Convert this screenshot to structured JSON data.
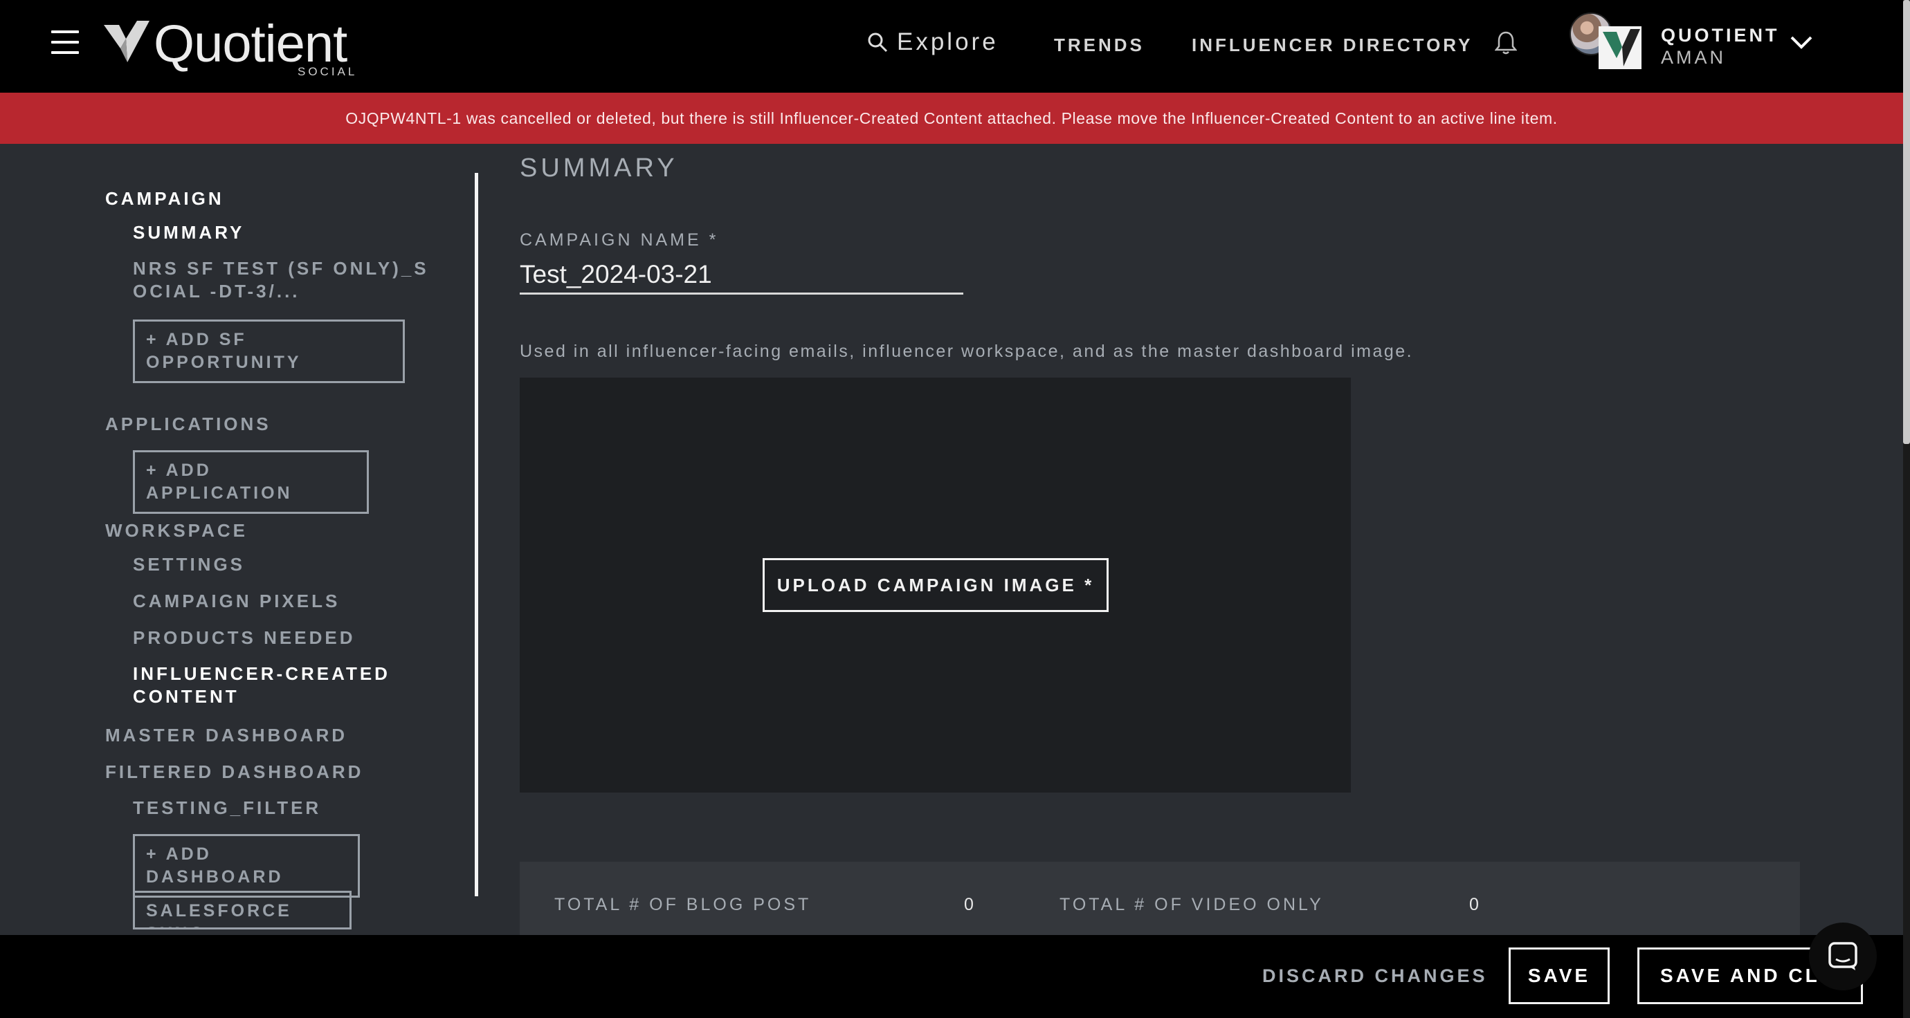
{
  "brand": {
    "name": "Quotient",
    "sub": "SOCIAL"
  },
  "nav": {
    "explore": "Explore",
    "trends": "TRENDS",
    "directory": "INFLUENCER DIRECTORY"
  },
  "user": {
    "org": "QUOTIENT",
    "name": "AMAN"
  },
  "alert": "OJQPW4NTL-1 was cancelled or deleted, but there is still Influencer-Created Content attached. Please move the Influencer-Created Content to an active line item.",
  "sidebar": {
    "campaign": "CAMPAIGN",
    "summary": "SUMMARY",
    "opportunity_line1": "NRS SF TEST (SF ONLY)_S",
    "opportunity_line2": "OCIAL -DT-3/...",
    "add_sf_line1": "+ ADD SF",
    "add_sf_line2": "OPPORTUNITY",
    "applications": "APPLICATIONS",
    "add_application": "+ ADD APPLICATION",
    "workspace": "WORKSPACE",
    "settings": "SETTINGS",
    "pixels": "CAMPAIGN PIXELS",
    "products": "PRODUCTS NEEDED",
    "icc_line1": "INFLUENCER-CREATED",
    "icc_line2": "CONTENT",
    "master_dashboard": "MASTER DASHBOARD",
    "filtered_dashboard": "FILTERED DASHBOARD",
    "testing_filter": "TESTING_FILTER",
    "add_dashboard": "+ ADD DASHBOARD",
    "salesforce_sync": "SALESFORCE SYNC"
  },
  "main": {
    "section_title": "SUMMARY",
    "campaign_name_label": "CAMPAIGN NAME *",
    "campaign_name_value": "Test_2024-03-21",
    "help_text": "Used in all influencer-facing emails, influencer workspace, and as the master dashboard image.",
    "upload_label": "UPLOAD CAMPAIGN IMAGE *",
    "stats": [
      {
        "label": "TOTAL # OF BLOG POST",
        "value": "0"
      },
      {
        "label": "TOTAL # OF VIDEO ONLY",
        "value": "0"
      }
    ]
  },
  "footer": {
    "discard": "DISCARD CHANGES",
    "save": "SAVE",
    "save_close": "SAVE AND CLOSE"
  },
  "colors": {
    "alert_bg": "#b8272f",
    "nav_bg": "#000000",
    "page_bg": "#2a2d32"
  }
}
